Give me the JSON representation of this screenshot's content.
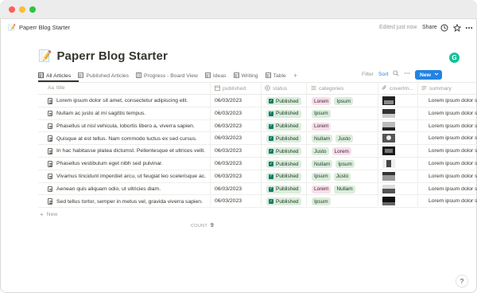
{
  "topbar": {
    "breadcrumb_icon": "pencil-emoji",
    "breadcrumb": "Paperr Blog Starter",
    "edited": "Edited just now",
    "share": "Share",
    "icons": [
      "clock-icon",
      "star-icon",
      "more-icon"
    ]
  },
  "page": {
    "emoji": "📝",
    "title": "Paperr Blog Starter"
  },
  "tabs": [
    {
      "icon": "table-icon",
      "label": "All Articles",
      "active": true
    },
    {
      "icon": "table-icon",
      "label": "Published Articles"
    },
    {
      "icon": "board-icon",
      "label": "Progress - Board View"
    },
    {
      "icon": "table-icon",
      "label": "Ideas"
    },
    {
      "icon": "table-icon",
      "label": "Writing"
    },
    {
      "icon": "table-icon",
      "label": "Table"
    }
  ],
  "toolbar": {
    "filter": "Filter",
    "sort": "Sort",
    "new": "New",
    "accent": "#2383e2"
  },
  "columns": {
    "title": "title",
    "published": "published",
    "status": "status",
    "categories": "categories",
    "cover": "coverIm...",
    "summary": "summary"
  },
  "rows": [
    {
      "title": "Lorem ipsum dolor sit amet, consectetur adipiscing elit.",
      "date": "06/03/2023",
      "status": "Published",
      "categories": [
        {
          "name": "Lorem",
          "color": "pink"
        },
        {
          "name": "Ipsum",
          "color": "green"
        }
      ],
      "cover": true,
      "summary": "Lorem ipsum dolor sit am"
    },
    {
      "title": "Nullam ac justo at mi sagittis tempus.",
      "date": "06/03/2023",
      "status": "Published",
      "categories": [
        {
          "name": "Ipsum",
          "color": "green"
        }
      ],
      "cover": true,
      "summary": "Lorem ipsum dolor sit am"
    },
    {
      "title": "Phasellus ut nisl vehicula, lobortis libero a, viverra sapien.",
      "date": "06/03/2023",
      "status": "Published",
      "categories": [
        {
          "name": "Lorem",
          "color": "pink"
        }
      ],
      "cover": true,
      "summary": "Lorem ipsum dolor sit am"
    },
    {
      "title": "Quisque at est tellus. Nam commodo luctus ex sed cursus.",
      "date": "06/03/2023",
      "status": "Published",
      "categories": [
        {
          "name": "Nullam",
          "color": "green"
        },
        {
          "name": "Justo",
          "color": "green"
        }
      ],
      "cover": true,
      "summary": "Lorem ipsum dolor sit am"
    },
    {
      "title": "In hac habitasse platea dictumst. Pellentesque et ultrices velit.",
      "date": "06/03/2023",
      "status": "Published",
      "categories": [
        {
          "name": "Justo",
          "color": "green"
        },
        {
          "name": "Lorem",
          "color": "pink"
        }
      ],
      "cover": true,
      "summary": "Lorem ipsum dolor sit am"
    },
    {
      "title": "Phasellus vestibulum eget nibh sed pulvinar.",
      "date": "06/03/2023",
      "status": "Published",
      "categories": [
        {
          "name": "Nullam",
          "color": "green"
        },
        {
          "name": "Ipsum",
          "color": "green"
        }
      ],
      "cover": true,
      "summary": "Lorem ipsum dolor sit am"
    },
    {
      "title": "Vivamus tincidunt imperdiet arcu, ut feugiat leo scelerisque ac.",
      "date": "06/03/2023",
      "status": "Published",
      "categories": [
        {
          "name": "Ipsum",
          "color": "green"
        },
        {
          "name": "Justo",
          "color": "green"
        }
      ],
      "cover": true,
      "summary": "Lorem ipsum dolor sit am"
    },
    {
      "title": "Aenean quis aliquam odio, ut ultricies diam.",
      "date": "06/03/2023",
      "status": "Published",
      "categories": [
        {
          "name": "Lorem",
          "color": "pink"
        },
        {
          "name": "Nullam",
          "color": "green"
        }
      ],
      "cover": true,
      "summary": "Lorem ipsum dolor sit am"
    },
    {
      "title": "Sed tellus tortor, semper in metus vel, gravida viverra sapien.",
      "date": "06/03/2023",
      "status": "Published",
      "categories": [
        {
          "name": "Ipsum",
          "color": "green"
        }
      ],
      "cover": true,
      "summary": "Lorem ipsum dolor sit am"
    }
  ],
  "footer": {
    "new_row": "New",
    "count_label": "COUNT",
    "count_value": "9",
    "help": "?"
  }
}
